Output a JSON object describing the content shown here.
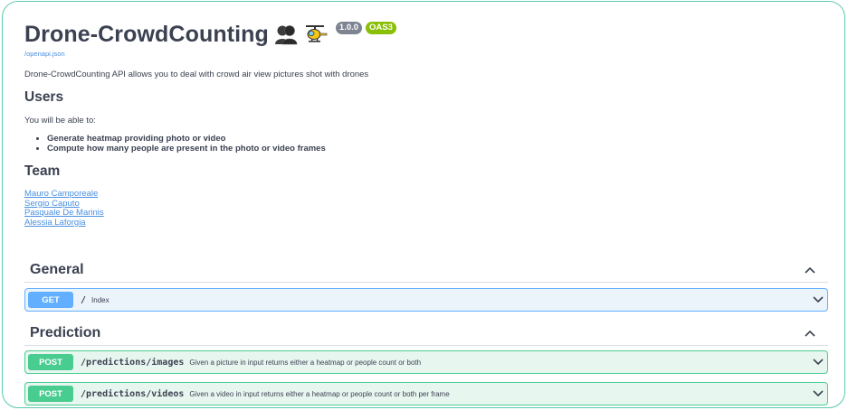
{
  "info": {
    "title": "Drone-CrowdCounting",
    "version_badge": "1.0.0",
    "oas_badge": "OAS3",
    "spec_link": "/openapi.json",
    "description": "Drone-CrowdCounting API allows you to deal with crowd air view pictures shot with drones",
    "users_heading": "Users",
    "users_intro": "You will be able to:",
    "features": [
      "Generate heatmap providing photo or video",
      "Compute how many people are present in the photo or video frames"
    ],
    "team_heading": "Team",
    "team": [
      "Mauro Camporeale",
      "Sergio Caputo",
      "Pasquale De Marinis",
      "Alessia Laforgia"
    ]
  },
  "tags": [
    {
      "name": "General",
      "operations": [
        {
          "method": "GET",
          "path": "/",
          "summary": "Index"
        }
      ]
    },
    {
      "name": "Prediction",
      "operations": [
        {
          "method": "POST",
          "path": "/predictions/images",
          "summary": "Given a picture in input returns either a heatmap or people count or both"
        },
        {
          "method": "POST",
          "path": "/predictions/videos",
          "summary": "Given a video in input returns either a heatmap or people count or both per frame"
        }
      ]
    }
  ],
  "icons": {
    "people": "busts-in-silhouette-icon",
    "helicopter": "helicopter-icon",
    "collapse": "chevron-up-icon",
    "expand": "chevron-down-icon"
  },
  "colors": {
    "get": "#61affe",
    "post": "#49cc90",
    "version_badge": "#7d8492",
    "oas_badge": "#89bf04",
    "link": "#4990e2",
    "frame_border": "#5cc9b0"
  }
}
